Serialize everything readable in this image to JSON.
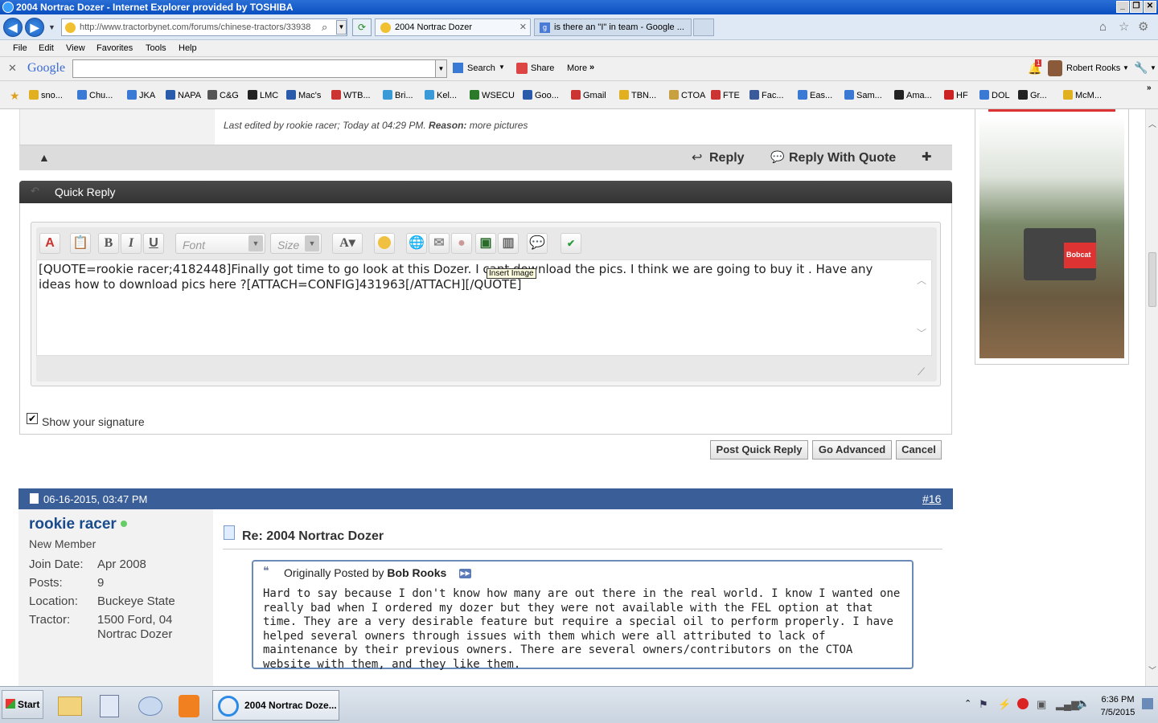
{
  "window": {
    "title": "2004 Nortrac Dozer - Internet Explorer provided by TOSHIBA"
  },
  "address": {
    "url": "http://www.tractorbynet.com/forums/chinese-tractors/33938"
  },
  "tabs": [
    {
      "label": "2004 Nortrac Dozer"
    },
    {
      "label": "is there an \"I\" in team - Google ..."
    }
  ],
  "menu": {
    "file": "File",
    "edit": "Edit",
    "view": "View",
    "favorites": "Favorites",
    "tools": "Tools",
    "help": "Help"
  },
  "googlebar": {
    "logo": "Google",
    "search": "Search",
    "share": "Share",
    "more": "More",
    "user": "Robert Rooks",
    "badge": "1"
  },
  "favorites": [
    "sno...",
    "Chu...",
    "JKA",
    "NAPA",
    "C&G",
    "LMC",
    "Mac's",
    "WTB...",
    "Bri...",
    "Kel...",
    "WSECU",
    "Goo...",
    "Gmail",
    "TBN...",
    "CTOA",
    "FTE",
    "Fac...",
    "Eas...",
    "Sam...",
    "Ama...",
    "HF",
    "DOL",
    "Gr...",
    "McM..."
  ],
  "post": {
    "last_edited_prefix": "Last edited by rookie racer; Today at 04:29 PM. ",
    "reason_label": "Reason:",
    "reason_text": " more pictures",
    "reply": "Reply",
    "reply_quote": "Reply With Quote"
  },
  "quick_reply": {
    "header": "Quick Reply",
    "font_placeholder": "Font",
    "size_placeholder": "Size",
    "editor_text": "[QUOTE=rookie racer;4182448]Finally got time to go look at this Dozer. I cant download the pics. I think we are going to buy it . Have any ideas how to download pics here ?[ATTACH=CONFIG]431963[/ATTACH][/QUOTE]",
    "tooltip": "Insert Image",
    "show_signature": "Show your signature",
    "post_button": "Post Quick Reply",
    "advanced_button": "Go Advanced",
    "cancel_button": "Cancel"
  },
  "post16": {
    "date": "06-16-2015, 03:47 PM",
    "number": "#16",
    "username": "rookie racer",
    "rank": "New Member",
    "join_label": "Join Date:",
    "join_value": "Apr 2008",
    "posts_label": "Posts:",
    "posts_value": "9",
    "location_label": "Location:",
    "location_value": "Buckeye State",
    "tractor_label": "Tractor:",
    "tractor_value1": "1500 Ford, 04",
    "tractor_value2": "Nortrac Dozer",
    "title": "Re: 2004 Nortrac Dozer",
    "quote_prefix": "Originally Posted by",
    "quote_author": "Bob Rooks",
    "quote_text": "Hard to say because I don't know how many are out there in the real world. I know I wanted one really bad when I ordered my dozer but they were not available with the FEL option at that time. They are a very desirable feature but require a special oil to perform properly. I have helped several owners through issues with them which were all attributed to lack of maintenance by their previous owners. There are several owners/contributors on the CTOA website with them, and they like them."
  },
  "ad": {
    "brand": "Bobcat"
  },
  "taskbar": {
    "start": "Start",
    "active_window": "2004 Nortrac Doze...",
    "time": "6:36 PM",
    "date": "7/5/2015"
  },
  "colors": {
    "title_blue": "#0a4fc0",
    "post_header": "#3a5f98",
    "username": "#1a4b8c",
    "dark_bar": "#3c3c3c"
  }
}
